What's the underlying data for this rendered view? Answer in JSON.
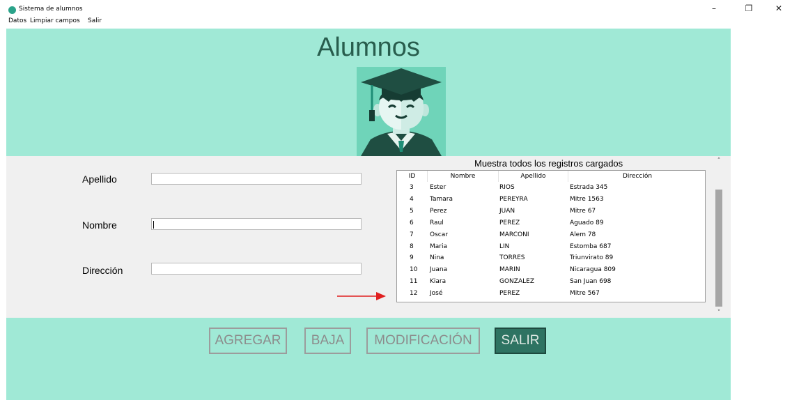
{
  "window": {
    "title": "Sistema de alumnos",
    "minimize": "–",
    "restore": "❐",
    "close": "✕"
  },
  "menu": {
    "items": [
      "Datos",
      "Limpiar campos",
      "Salir"
    ]
  },
  "header": {
    "title": "Alumnos",
    "avatar_icon": "graduate-avatar-icon"
  },
  "form": {
    "apellido_label": "Apellido",
    "apellido_value": "",
    "nombre_label": "Nombre",
    "nombre_value": "",
    "direccion_label": "Dirección",
    "direccion_value": ""
  },
  "table": {
    "caption": "Muestra todos los registros cargados",
    "columns": [
      "ID",
      "Nombre",
      "Apellido",
      "Dirección"
    ],
    "rows": [
      [
        "3",
        "Ester",
        "RIOS",
        "Estrada 345"
      ],
      [
        "4",
        "Tamara",
        "PEREYRA",
        "Mitre 1563"
      ],
      [
        "5",
        "Perez",
        "JUAN",
        "Mitre 67"
      ],
      [
        "6",
        "Raul",
        "PEREZ",
        "Aguado 89"
      ],
      [
        "7",
        "Oscar",
        "MARCONI",
        "Alem 78"
      ],
      [
        "8",
        "Maria",
        "LIN",
        "Estomba 687"
      ],
      [
        "9",
        "Nina",
        "TORRES",
        "Triunvirato 89"
      ],
      [
        "10",
        "Juana",
        "MARIN",
        "Nicaragua 809"
      ],
      [
        "11",
        "Kiara",
        "GONZALEZ",
        "San Juan 698"
      ],
      [
        "12",
        "José",
        "PEREZ",
        "Mitre 567"
      ]
    ]
  },
  "scroll": {
    "up": "˄",
    "down": "˅"
  },
  "buttons": {
    "agregar": "AGREGAR",
    "baja": "BAJA",
    "modificacion": "MODIFICACIÓN",
    "salir": "SALIR"
  },
  "colors": {
    "panel": "#a0e9d6",
    "title": "#285d4d",
    "salir_button": "#2e7362",
    "arrow": "#e02020"
  }
}
